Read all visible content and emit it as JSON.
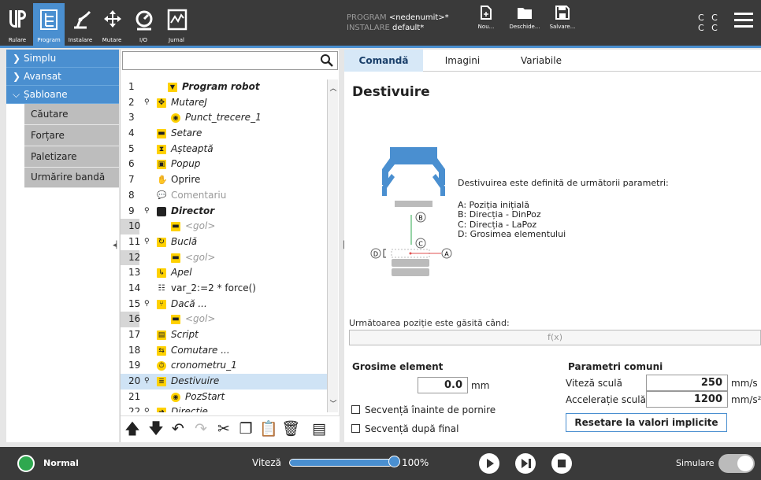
{
  "header": {
    "nav_buttons": [
      {
        "label": "Rulare",
        "icon": "ur-logo-icon"
      },
      {
        "label": "Program",
        "icon": "program-tree-icon"
      },
      {
        "label": "Instalare",
        "icon": "robot-arm-icon"
      },
      {
        "label": "Mutare",
        "icon": "move-arrows-icon"
      },
      {
        "label": "I/O",
        "icon": "io-gauge-icon"
      },
      {
        "label": "Jurnal",
        "icon": "log-chart-icon"
      }
    ],
    "program_label": "PROGRAM",
    "program_value": "<nedenumit>*",
    "install_label": "INSTALARE",
    "install_value": "default*",
    "file_buttons": [
      {
        "label": "Nou...",
        "icon": "new-file-icon"
      },
      {
        "label": "Deschide...",
        "icon": "open-folder-icon"
      },
      {
        "label": "Salvare...",
        "icon": "save-icon"
      }
    ],
    "cc_line1": "C C",
    "cc_line2": "C C"
  },
  "nav": {
    "categories": [
      {
        "label": "Simplu",
        "expanded": false
      },
      {
        "label": "Avansat",
        "expanded": false
      },
      {
        "label": "Șabloane",
        "expanded": true
      }
    ],
    "subitems": [
      "Căutare",
      "Forțare",
      "Paletizare",
      "Urmărire bandă"
    ]
  },
  "tree": {
    "search_value": "",
    "rows": [
      {
        "n": "1",
        "text": "Program robot"
      },
      {
        "n": "2",
        "text": "MutareJ"
      },
      {
        "n": "3",
        "text": "Punct_trecere_1"
      },
      {
        "n": "4",
        "text": "Setare"
      },
      {
        "n": "5",
        "text": "Așteaptă"
      },
      {
        "n": "6",
        "text": "Popup"
      },
      {
        "n": "7",
        "text": "Oprire"
      },
      {
        "n": "8",
        "text": "Comentariu"
      },
      {
        "n": "9",
        "text": "Director"
      },
      {
        "n": "10",
        "text": "<gol>"
      },
      {
        "n": "11",
        "text": "Buclă"
      },
      {
        "n": "12",
        "text": "<gol>"
      },
      {
        "n": "13",
        "text": "Apel"
      },
      {
        "n": "14",
        "text": "var_2:=2 * force()"
      },
      {
        "n": "15",
        "text": "Dacă ..."
      },
      {
        "n": "16",
        "text": "<gol>"
      },
      {
        "n": "17",
        "text": "Script"
      },
      {
        "n": "18",
        "text": "Comutare ..."
      },
      {
        "n": "19",
        "text": "cronometru_1"
      },
      {
        "n": "20",
        "text": "Destivuire"
      },
      {
        "n": "21",
        "text": "PozStart"
      },
      {
        "n": "22",
        "text": "Direcție"
      }
    ],
    "toolbar": [
      "move-up-icon",
      "move-down-icon",
      "undo-icon",
      "redo-icon",
      "cut-icon",
      "copy-icon",
      "paste-icon",
      "delete-icon",
      "suppress-icon"
    ]
  },
  "panel": {
    "tabs": [
      "Comandă",
      "Imagini",
      "Variabile"
    ],
    "title": "Destivuire",
    "description": "Destivuirea este definită de următorii parametri:",
    "params": [
      "A: Poziția inițială",
      "B: Direcția - DinPoz",
      "C: Direcția - LaPoz",
      "D: Grosimea elementului"
    ],
    "diagram_labels": {
      "a": "A",
      "b": "B",
      "c": "C",
      "d": "D"
    },
    "next_pos_label": "Următoarea poziție este găsită când:",
    "expression": "f(x)",
    "thickness_label": "Grosime element",
    "thickness_value": "0.0",
    "thickness_unit": "mm",
    "common_label": "Parametri comuni",
    "speed_label": "Viteză sculă",
    "speed_value": "250",
    "speed_unit": "mm/s",
    "accel_label": "Accelerație sculă",
    "accel_value": "1200",
    "accel_unit": "mm/s²",
    "seq_before": "Secvență înainte de pornire",
    "seq_after": "Secvență după final",
    "reset_button": "Resetare la valori implicite"
  },
  "footer": {
    "status": "Normal",
    "speed_label": "Viteză",
    "speed_fraction": 1.0,
    "speed_percent": "100%",
    "sim_label": "Simulare",
    "colors": {
      "status_ok": "#2fa84f",
      "accent": "#4a8fd0"
    }
  }
}
